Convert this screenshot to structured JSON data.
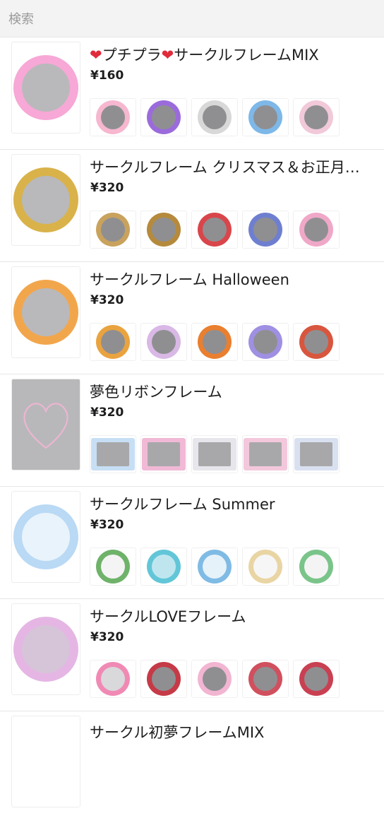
{
  "search": {
    "placeholder": "検索"
  },
  "products": [
    {
      "title_parts": [
        "❤",
        "プチプラ",
        "❤",
        "サークルフレームMIX"
      ],
      "price": "¥160",
      "main_color": "#f7a8d6",
      "subs": [
        "#f6b7cf",
        "#9b6bdc",
        "#d8d8d8",
        "#7db8e8",
        "#f1c9d9"
      ]
    },
    {
      "title": "サークルフレーム クリスマス＆お正月…",
      "price": "¥320",
      "main_color": "#d9b24a",
      "subs": [
        "#c9a25d",
        "#b58a3d",
        "#d8464b",
        "#6f7fd0",
        "#f0a8c8"
      ]
    },
    {
      "title": "サークルフレーム Halloween",
      "price": "¥320",
      "main_color": "#f2a64c",
      "subs": [
        "#e9a33f",
        "#d9b8e6",
        "#e97f2f",
        "#9f90e3",
        "#d8563e"
      ]
    },
    {
      "title": "夢色リボンフレーム",
      "price": "¥320",
      "main_color": "#f1b5d3",
      "subs": [
        "#c7dff5",
        "#f1b9d6",
        "#e6e6ec",
        "#f4c8dc",
        "#d9e1f1"
      ]
    },
    {
      "title": "サークルフレーム Summer",
      "price": "¥320",
      "main_color": "#b9d9f5",
      "subs": [
        "#6fb26a",
        "#62c6d8",
        "#7fbbe4",
        "#e9d5a4",
        "#7ac48a"
      ]
    },
    {
      "title": "サークルLOVEフレーム",
      "price": "¥320",
      "main_color": "#e5b6e4",
      "subs": [
        "#f08ab4",
        "#c53a46",
        "#f2b5d2",
        "#d1505e",
        "#c94052"
      ]
    }
  ],
  "partial_title": "サークル初夢フレームMIX"
}
